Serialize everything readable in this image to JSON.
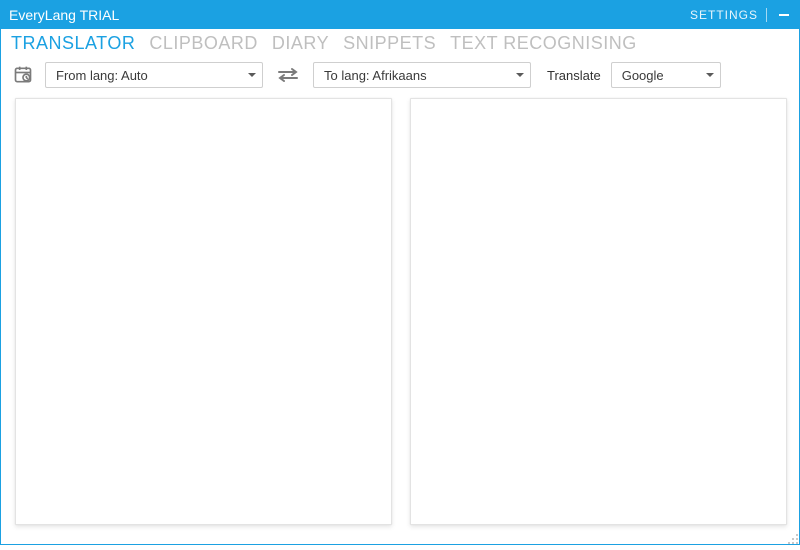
{
  "titlebar": {
    "title": "EveryLang TRIAL",
    "settings": "SETTINGS"
  },
  "tabs": [
    {
      "label": "TRANSLATOR",
      "active": true
    },
    {
      "label": "CLIPBOARD",
      "active": false
    },
    {
      "label": "DIARY",
      "active": false
    },
    {
      "label": "SNIPPETS",
      "active": false
    },
    {
      "label": "TEXT RECOGNISING",
      "active": false
    }
  ],
  "toolbar": {
    "from_lang_label": "From lang: Auto",
    "to_lang_label": "To lang: Afrikaans",
    "translate_label": "Translate",
    "engine": "Google"
  },
  "panes": {
    "source_text": "",
    "target_text": ""
  },
  "icons": {
    "history": "history-icon",
    "swap": "swap-arrows-icon",
    "minimize": "minimize-icon",
    "caret": "caret-down-icon",
    "resize": "resize-grip-icon"
  },
  "colors": {
    "accent": "#1ba1e2",
    "tab_inactive": "#bfbfbf",
    "border": "#cfcfcf"
  }
}
